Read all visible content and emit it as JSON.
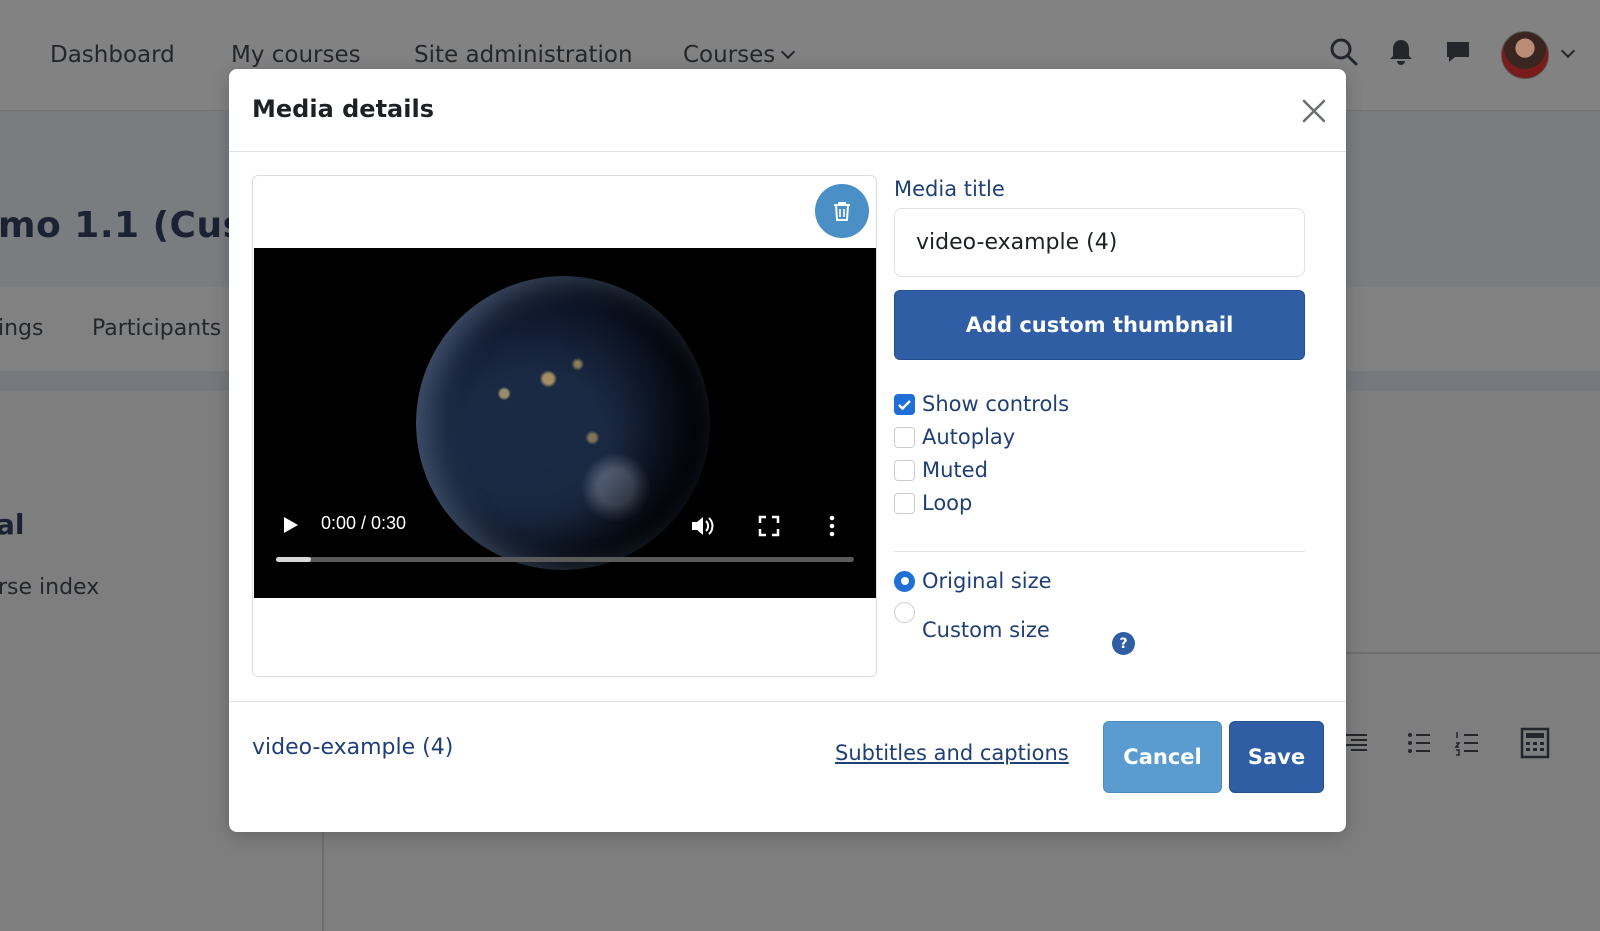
{
  "nav": {
    "items": [
      "Dashboard",
      "My courses",
      "Site administration",
      "Courses"
    ]
  },
  "course": {
    "title": "mo 1.1 (Custon",
    "secondary_nav": [
      "ings",
      "Participants"
    ],
    "side_heading": "al",
    "side_link": "rse index"
  },
  "modal": {
    "title": "Media details",
    "video": {
      "time": "0:00 / 0:30",
      "progress": 0.06
    },
    "form": {
      "media_title_label": "Media title",
      "media_title_value": "video-example (4)",
      "thumbnail_button": "Add custom thumbnail",
      "options": [
        {
          "label": "Show controls",
          "checked": true
        },
        {
          "label": "Autoplay",
          "checked": false
        },
        {
          "label": "Muted",
          "checked": false
        },
        {
          "label": "Loop",
          "checked": false
        }
      ],
      "size_options": [
        {
          "label": "Original size",
          "selected": true
        },
        {
          "label": "Custom size",
          "selected": false
        }
      ],
      "help": "?"
    },
    "footer": {
      "file_name": "video-example (4)",
      "subtitles_link": "Subtitles and captions",
      "cancel_label": "Cancel",
      "save_label": "Save"
    }
  },
  "colors": {
    "primary": "#2f5ea4",
    "secondary": "#5a9bd0",
    "checked": "#1f6fd6",
    "overlay": "#7e7e7e"
  }
}
